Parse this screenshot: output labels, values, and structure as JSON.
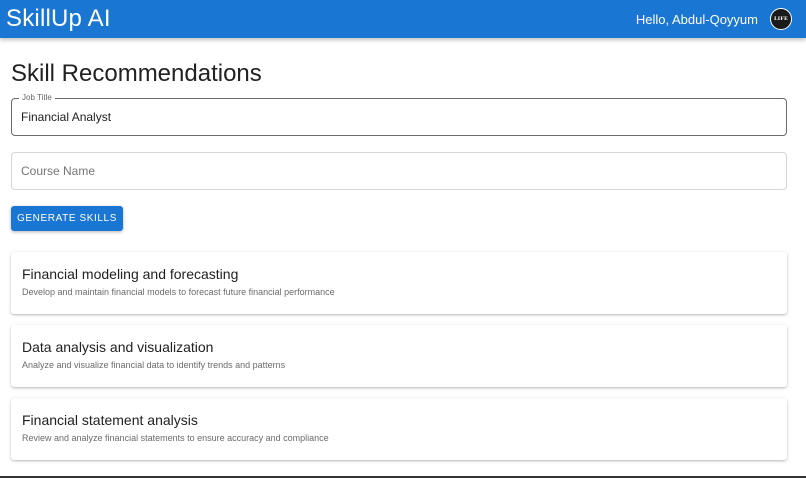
{
  "app": {
    "brand": "SkillUp AI",
    "greeting": "Hello, Abdul-Qoyyum",
    "avatar_text": "LIFE",
    "accent_color": "#1976d2"
  },
  "page": {
    "title": "Skill Recommendations"
  },
  "form": {
    "job_title_label": "Job Title",
    "job_title_value": "Financial Analyst",
    "course_name_placeholder": "Course Name",
    "course_name_value": "",
    "generate_label": "GENERATE SKILLS"
  },
  "skills": [
    {
      "title": "Financial modeling and forecasting",
      "description": "Develop and maintain financial models to forecast future financial performance"
    },
    {
      "title": "Data analysis and visualization",
      "description": "Analyze and visualize financial data to identify trends and patterns"
    },
    {
      "title": "Financial statement analysis",
      "description": "Review and analyze financial statements to ensure accuracy and compliance"
    }
  ]
}
